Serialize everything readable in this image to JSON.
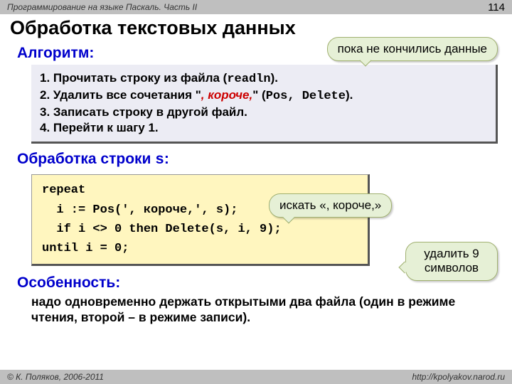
{
  "header": {
    "course": "Программирование на языке Паскаль. Часть II",
    "page": "114"
  },
  "title": "Обработка текстовых данных",
  "algo": {
    "heading": "Алгоритм:",
    "s1a": "1. Прочитать строку из файла (",
    "s1b": "readln",
    "s1c": ").",
    "s2a": "2. Удалить все сочетания \"",
    "s2b": ", короче,",
    "s2c": "\" (",
    "s2d": "Pos",
    "s2e": ", ",
    "s2f": "Delete",
    "s2g": ").",
    "s3": "3. Записать строку в другой файл.",
    "s4": "4. Перейти к шагу 1."
  },
  "callout1": "пока не кончились данные",
  "proc": {
    "heading_a": "Обработка строки ",
    "heading_b": "s",
    "heading_c": ":"
  },
  "code": "repeat\n  i := Pos(', короче,', s);\n  if i <> 0 then Delete(s, i, 9);\nuntil i = 0;",
  "callout2": "искать «, короче,»",
  "callout3": "удалить 9 символов",
  "feature": {
    "heading": "Особенность:",
    "text": "надо одновременно держать открытыми два файла (один в режиме чтения, второй – в режиме записи)."
  },
  "footer": {
    "left": "© К. Поляков, 2006-2011",
    "right": "http://kpolyakov.narod.ru"
  }
}
